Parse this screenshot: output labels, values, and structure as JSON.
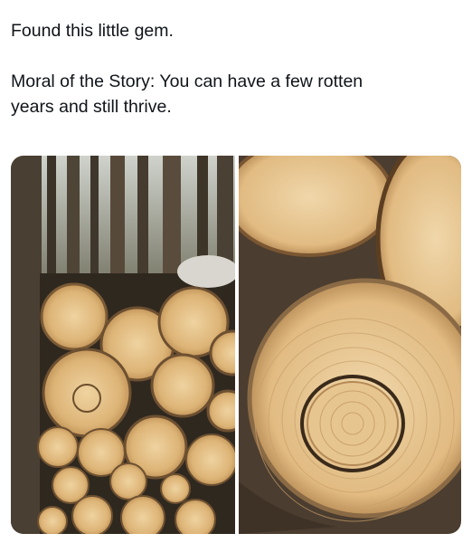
{
  "post": {
    "line1": "Found this little gem.",
    "line2": "Moral of the Story: You can have a few rotten",
    "line3": "years and still thrive."
  },
  "media": {
    "image_icon": "photo-collage",
    "colors": {
      "wood_light": "#e8c68e",
      "wood_mid": "#d5a86a",
      "bark": "#5b4d3e",
      "forest": "#3d3a2c"
    }
  }
}
